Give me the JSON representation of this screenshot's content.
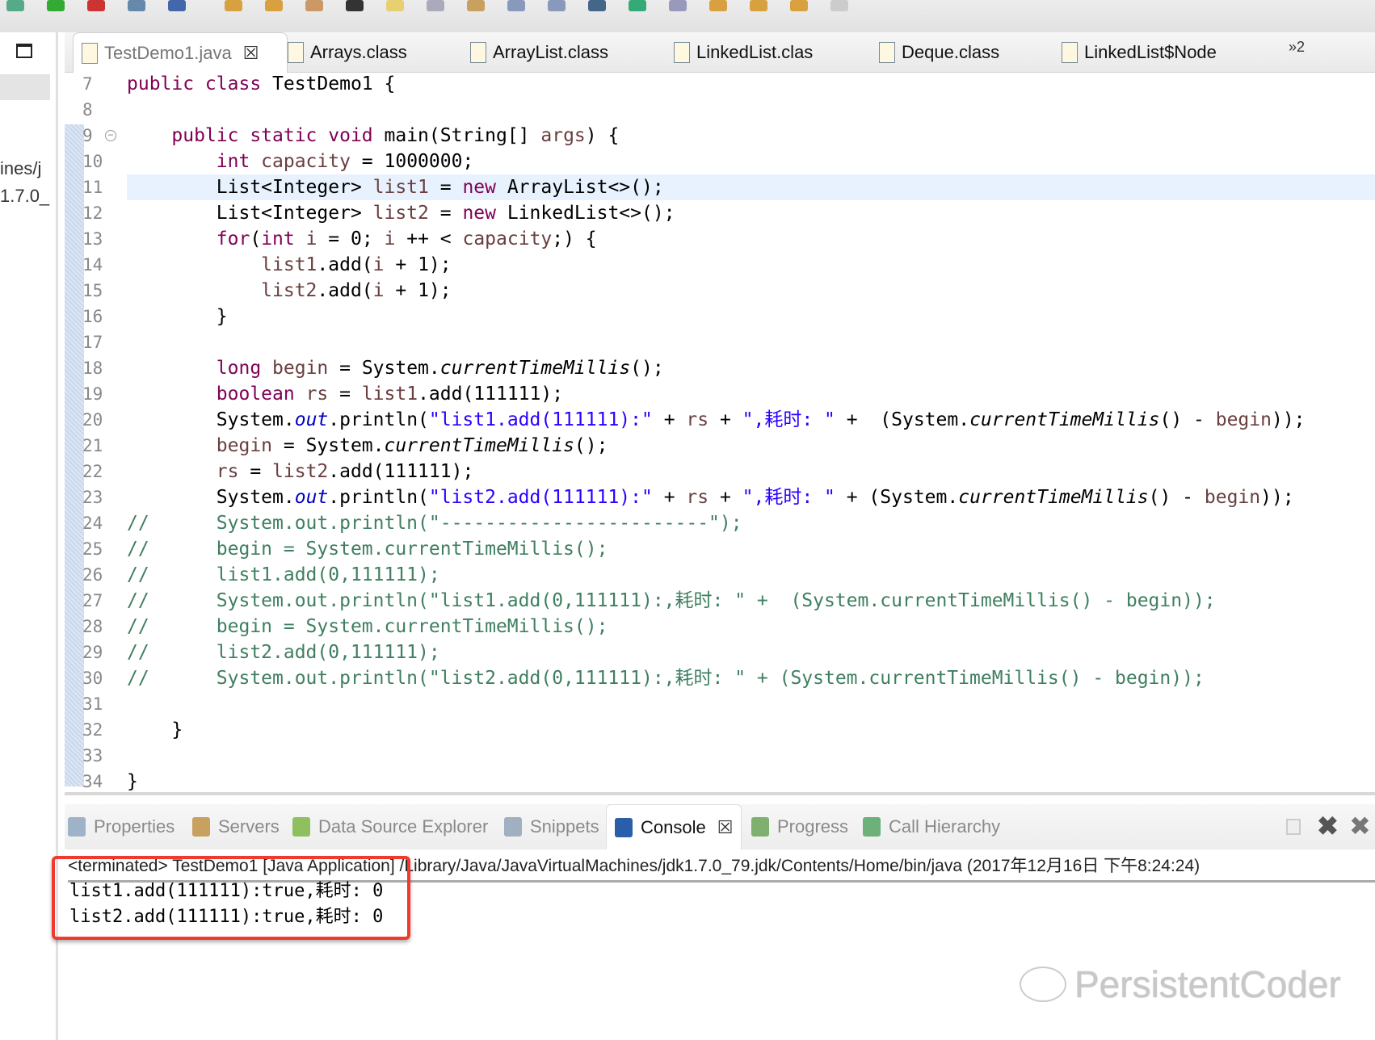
{
  "editor_tabs": [
    {
      "label": "TestDemo1.java",
      "icon": "java-file-icon",
      "active": true,
      "closable": true
    },
    {
      "label": "Arrays.class",
      "icon": "class-file-icon"
    },
    {
      "label": "ArrayList.class",
      "icon": "class-file-icon"
    },
    {
      "label": "LinkedList.clas",
      "icon": "class-file-icon"
    },
    {
      "label": "Deque.class",
      "icon": "class-file-icon"
    },
    {
      "label": "LinkedList$Node",
      "icon": "class-file-icon"
    }
  ],
  "overflow_label": "»2",
  "left_pane": {
    "lines": [
      "ines/j",
      "1.7.0_"
    ]
  },
  "code_lines": [
    {
      "n": "7",
      "t": [
        [
          "public class ",
          "kw"
        ],
        [
          "TestDemo1 {",
          ""
        ]
      ]
    },
    {
      "n": "8",
      "t": []
    },
    {
      "n": "9",
      "fold": true,
      "t": [
        [
          "    ",
          ""
        ],
        [
          "public static void ",
          "kw"
        ],
        [
          "main(String[] ",
          ""
        ],
        [
          "args",
          "var"
        ],
        [
          ") {",
          ""
        ]
      ]
    },
    {
      "n": "10",
      "t": [
        [
          "        ",
          ""
        ],
        [
          "int ",
          "kw"
        ],
        [
          "capacity",
          "var"
        ],
        [
          " = 1000000;",
          ""
        ]
      ]
    },
    {
      "n": "11",
      "hl": true,
      "t": [
        [
          "        List<Integer> ",
          ""
        ],
        [
          "list1",
          "var"
        ],
        [
          " = ",
          ""
        ],
        [
          "new",
          "kw"
        ],
        [
          " ArrayList<>();",
          ""
        ]
      ]
    },
    {
      "n": "12",
      "t": [
        [
          "        List<Integer> ",
          ""
        ],
        [
          "list2",
          "var"
        ],
        [
          " = ",
          ""
        ],
        [
          "new",
          "kw"
        ],
        [
          " LinkedList<>();",
          ""
        ]
      ]
    },
    {
      "n": "13",
      "t": [
        [
          "        ",
          ""
        ],
        [
          "for",
          "kw"
        ],
        [
          "(",
          ""
        ],
        [
          "int ",
          "kw"
        ],
        [
          "i",
          "var"
        ],
        [
          " = 0; ",
          ""
        ],
        [
          "i",
          "var"
        ],
        [
          " ++ < ",
          ""
        ],
        [
          "capacity",
          "var"
        ],
        [
          ";) {",
          ""
        ]
      ]
    },
    {
      "n": "14",
      "t": [
        [
          "            ",
          ""
        ],
        [
          "list1",
          "var"
        ],
        [
          ".add(",
          ""
        ],
        [
          "i",
          "var"
        ],
        [
          " + 1);",
          ""
        ]
      ]
    },
    {
      "n": "15",
      "t": [
        [
          "            ",
          ""
        ],
        [
          "list2",
          "var"
        ],
        [
          ".add(",
          ""
        ],
        [
          "i",
          "var"
        ],
        [
          " + 1);",
          ""
        ]
      ]
    },
    {
      "n": "16",
      "t": [
        [
          "        }",
          ""
        ]
      ]
    },
    {
      "n": "17",
      "t": []
    },
    {
      "n": "18",
      "t": [
        [
          "        ",
          ""
        ],
        [
          "long ",
          "kw"
        ],
        [
          "begin",
          "var"
        ],
        [
          " = System.",
          ""
        ],
        [
          "currentTimeMillis",
          "it"
        ],
        [
          "();",
          ""
        ]
      ]
    },
    {
      "n": "19",
      "t": [
        [
          "        ",
          ""
        ],
        [
          "boolean ",
          "kw"
        ],
        [
          "rs",
          "var"
        ],
        [
          " = ",
          ""
        ],
        [
          "list1",
          "var"
        ],
        [
          ".add(111111);",
          ""
        ]
      ]
    },
    {
      "n": "20",
      "t": [
        [
          "        System.",
          ""
        ],
        [
          "out",
          "field"
        ],
        [
          ".println(",
          ""
        ],
        [
          "\"list1.add(111111):\"",
          "str"
        ],
        [
          " + ",
          ""
        ],
        [
          "rs",
          "var"
        ],
        [
          " + ",
          ""
        ],
        [
          "\",耗时: \"",
          "str"
        ],
        [
          " +  (System.",
          ""
        ],
        [
          "currentTimeMillis",
          "it"
        ],
        [
          "() - ",
          ""
        ],
        [
          "begin",
          "var"
        ],
        [
          "));",
          ""
        ]
      ]
    },
    {
      "n": "21",
      "t": [
        [
          "        ",
          ""
        ],
        [
          "begin",
          "var"
        ],
        [
          " = System.",
          ""
        ],
        [
          "currentTimeMillis",
          "it"
        ],
        [
          "();",
          ""
        ]
      ]
    },
    {
      "n": "22",
      "t": [
        [
          "        ",
          ""
        ],
        [
          "rs",
          "var"
        ],
        [
          " = ",
          ""
        ],
        [
          "list2",
          "var"
        ],
        [
          ".add(111111);",
          ""
        ]
      ]
    },
    {
      "n": "23",
      "t": [
        [
          "        System.",
          ""
        ],
        [
          "out",
          "field"
        ],
        [
          ".println(",
          ""
        ],
        [
          "\"list2.add(111111):\"",
          "str"
        ],
        [
          " + ",
          ""
        ],
        [
          "rs",
          "var"
        ],
        [
          " + ",
          ""
        ],
        [
          "\",耗时: \"",
          "str"
        ],
        [
          " + (System.",
          ""
        ],
        [
          "currentTimeMillis",
          "it"
        ],
        [
          "() - ",
          ""
        ],
        [
          "begin",
          "var"
        ],
        [
          "));",
          ""
        ]
      ]
    },
    {
      "n": "24",
      "t": [
        [
          "//      System.out.println(\"------------------------\");",
          "cm"
        ]
      ]
    },
    {
      "n": "25",
      "t": [
        [
          "//      begin = System.currentTimeMillis();",
          "cm"
        ]
      ]
    },
    {
      "n": "26",
      "t": [
        [
          "//      list1.add(0,111111);",
          "cm"
        ]
      ]
    },
    {
      "n": "27",
      "t": [
        [
          "//      System.out.println(\"list1.add(0,111111):,耗时: \" +  (System.currentTimeMillis() - begin));",
          "cm"
        ]
      ]
    },
    {
      "n": "28",
      "t": [
        [
          "//      begin = System.currentTimeMillis();",
          "cm"
        ]
      ]
    },
    {
      "n": "29",
      "t": [
        [
          "//      list2.add(0,111111);",
          "cm"
        ]
      ]
    },
    {
      "n": "30",
      "t": [
        [
          "//      System.out.println(\"list2.add(0,111111):,耗时: \" + (System.currentTimeMillis() - begin));",
          "cm"
        ]
      ]
    },
    {
      "n": "31",
      "t": []
    },
    {
      "n": "32",
      "t": [
        [
          "    }",
          ""
        ]
      ]
    },
    {
      "n": "33",
      "t": []
    },
    {
      "n": "34",
      "t": [
        [
          "}",
          ""
        ]
      ]
    }
  ],
  "panel_tabs": [
    {
      "label": "Properties",
      "icon": "properties-icon",
      "color": "#9fb3c8"
    },
    {
      "label": "Servers",
      "icon": "servers-icon",
      "color": "#c8a060"
    },
    {
      "label": "Data Source Explorer",
      "icon": "data-source-icon",
      "color": "#8fc060"
    },
    {
      "label": "Snippets",
      "icon": "snippets-icon",
      "color": "#a0b0c0"
    },
    {
      "label": "Console",
      "icon": "console-icon",
      "color": "#2a5ea8",
      "active": true
    },
    {
      "label": "Progress",
      "icon": "progress-icon",
      "color": "#7fb070"
    },
    {
      "label": "Call Hierarchy",
      "icon": "call-hierarchy-icon",
      "color": "#6cb07a"
    }
  ],
  "console": {
    "header": "<terminated> TestDemo1 [Java Application] /Library/Java/JavaVirtualMachines/jdk1.7.0_79.jdk/Contents/Home/bin/java (2017年12月16日 下午8:24:24)",
    "output": [
      "list1.add(111111):true,耗时: 0",
      "list2.add(111111):true,耗时: 0"
    ]
  },
  "watermark": "PersistentCoder",
  "colors": {
    "keyword": "#7f0055",
    "local_var": "#6a3e3e",
    "string": "#2a00ff",
    "field": "#0000c0",
    "comment": "#3f7f5f",
    "current_line": "#e8f2fe",
    "highlight_box": "#f03a2e"
  }
}
